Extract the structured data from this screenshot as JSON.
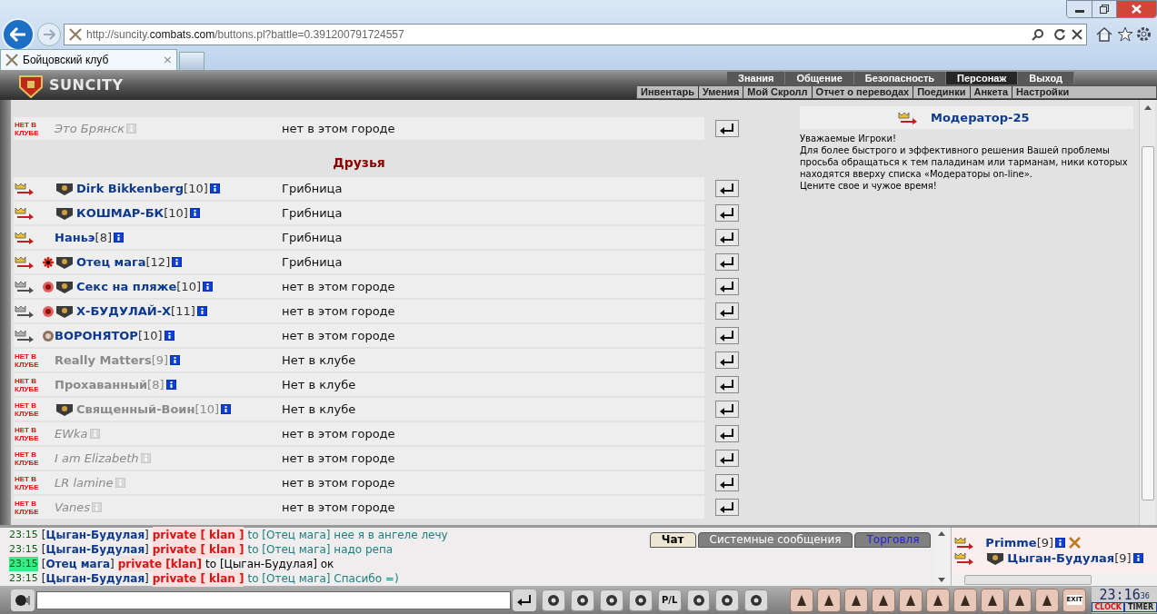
{
  "browser": {
    "url": "http://suncity.**combats.com**/buttons.pl?battle=0.391200791724557",
    "tab": {
      "title": "Бойцовский клуб",
      "close": "×"
    }
  },
  "game": {
    "logo": "SUNCITY",
    "menu": [
      {
        "label": "Знания",
        "selected": false
      },
      {
        "label": "Общение",
        "selected": false
      },
      {
        "label": "Безопасность",
        "selected": false
      },
      {
        "label": "Персонаж",
        "selected": true
      },
      {
        "label": "Выход",
        "selected": false
      }
    ],
    "submenu": [
      "Инвентарь",
      "Умения",
      "Мой Скролл",
      "Отчет о переводах",
      "Поединки",
      "Анкета",
      "Настройки"
    ]
  },
  "contacts": {
    "top_rows": [
      {
        "kind": "offline",
        "badge": "НЕТ В КЛУБЕ",
        "name": "Это Брянск",
        "clan": false,
        "location": "нет в этом городе"
      }
    ],
    "sections": [
      {
        "title": "Друзья",
        "rows": [
          {
            "kind": "here",
            "name": "Dirk Bikkenberg",
            "rank": "[10]",
            "clan": true,
            "location": "Грибница"
          },
          {
            "kind": "here",
            "name": "КОШМАР-БК",
            "rank": "[10]",
            "clan": true,
            "location": "Грибница"
          },
          {
            "kind": "here",
            "name": "Наньэ",
            "rank": "[8]",
            "clan": false,
            "location": "Грибница"
          },
          {
            "kind": "here",
            "align": {
              "kind": "cross"
            },
            "name": "Отец мага",
            "rank": "[12]",
            "clan": true,
            "location": "Грибница"
          },
          {
            "kind": "elsewhere",
            "align": {
              "kind": "sun"
            },
            "name": "Секс на пляже",
            "rank": "[10]",
            "clan": true,
            "location": "нет в этом городе"
          },
          {
            "kind": "elsewhere",
            "align": {
              "kind": "sun"
            },
            "name": "Х-БУДУЛАЙ-Х",
            "rank": "[11]",
            "clan": true,
            "location": "нет в этом городе"
          },
          {
            "kind": "elsewhere",
            "align": {
              "kind": "shield"
            },
            "name": "ВОРОНЯТОР",
            "rank": "[10]",
            "clan": false,
            "location": "нет в этом городе"
          },
          {
            "kind": "offline",
            "badge": "НЕТ В КЛУБЕ",
            "name": "Really Matters",
            "rank": "[9]",
            "clan": false,
            "location": "Нет в клубе"
          },
          {
            "kind": "offline",
            "badge": "НЕТ В КЛУБЕ",
            "name": "Прохаванный",
            "rank": "[8]",
            "clan": false,
            "location": "Нет в клубе"
          },
          {
            "kind": "offline",
            "badge": "НЕТ В КЛУБЕ",
            "name": "Священный-Воин",
            "rank": "[10]",
            "clan": true,
            "location": "Нет в клубе"
          },
          {
            "kind": "offline",
            "badge": "НЕТ В КЛУБЕ",
            "name": "EWka",
            "clan": false,
            "location": "нет в этом городе"
          },
          {
            "kind": "offline",
            "badge": "НЕТ В КЛУБЕ",
            "name": "I am Elizabeth",
            "clan": false,
            "location": "нет в этом городе"
          },
          {
            "kind": "offline",
            "badge": "НЕТ В КЛУБЕ",
            "name": "LR lamine",
            "clan": false,
            "location": "нет в этом городе"
          },
          {
            "kind": "offline",
            "badge": "НЕТ В КЛУБЕ",
            "name": "Vanes",
            "clan": false,
            "location": "нет в этом городе"
          }
        ]
      }
    ]
  },
  "notice": {
    "moderator": "Модератор-25",
    "greeting": "Уважаемые Игроки!",
    "body": "Для более быстрого и эффективного решения Вашей проблемы просьба обращаться к тем паладинам или тарманам, ники которых находятся вверху списка «Модераторы on-line».",
    "closing": "Цените свое и чужое время!"
  },
  "chat": {
    "messages": [
      {
        "time": "23:15",
        "sender": "[**Цыган-Будулая**]",
        "tag": "private [ klan ]",
        "text": "to [Отец мага] нее я в ангеле лечу",
        "highlighted": false
      },
      {
        "time": "23:15",
        "sender": "[**Цыган-Будулая**]",
        "tag": "private [ klan ]",
        "text": "to [Отец мага] надо репа",
        "highlighted": false
      },
      {
        "time": "23:15",
        "sender": "[**Отец мага**]",
        "tag": "private [klan]",
        "text": "to [Цыган-Будулая] ок",
        "highlighted": true
      },
      {
        "time": "23:15",
        "sender": "[**Цыган-Будулая**]",
        "tag": "private [ klan ]",
        "text": "to [Отец мага] Спасибо =)",
        "highlighted": false
      }
    ],
    "tabs": [
      {
        "label": "Чат",
        "selected": true,
        "kind": "chat"
      },
      {
        "label": "Системные сообщения",
        "selected": false,
        "kind": "system"
      },
      {
        "label": "Торговля",
        "selected": false,
        "kind": "trade"
      }
    ],
    "online": [
      {
        "name": "Primme",
        "rank": "[9]",
        "clan": false,
        "silenced": true
      },
      {
        "name": "Цыган-Будулая",
        "rank": "[9]",
        "clan": true,
        "silenced": false
      }
    ]
  },
  "toolbar": {
    "pl_label": "P/L",
    "exit_label": "EXIT",
    "clock": {
      "time": "23:16",
      "seconds": "36",
      "clock_label": "CLOCK",
      "timer_label": "TIMER"
    }
  }
}
